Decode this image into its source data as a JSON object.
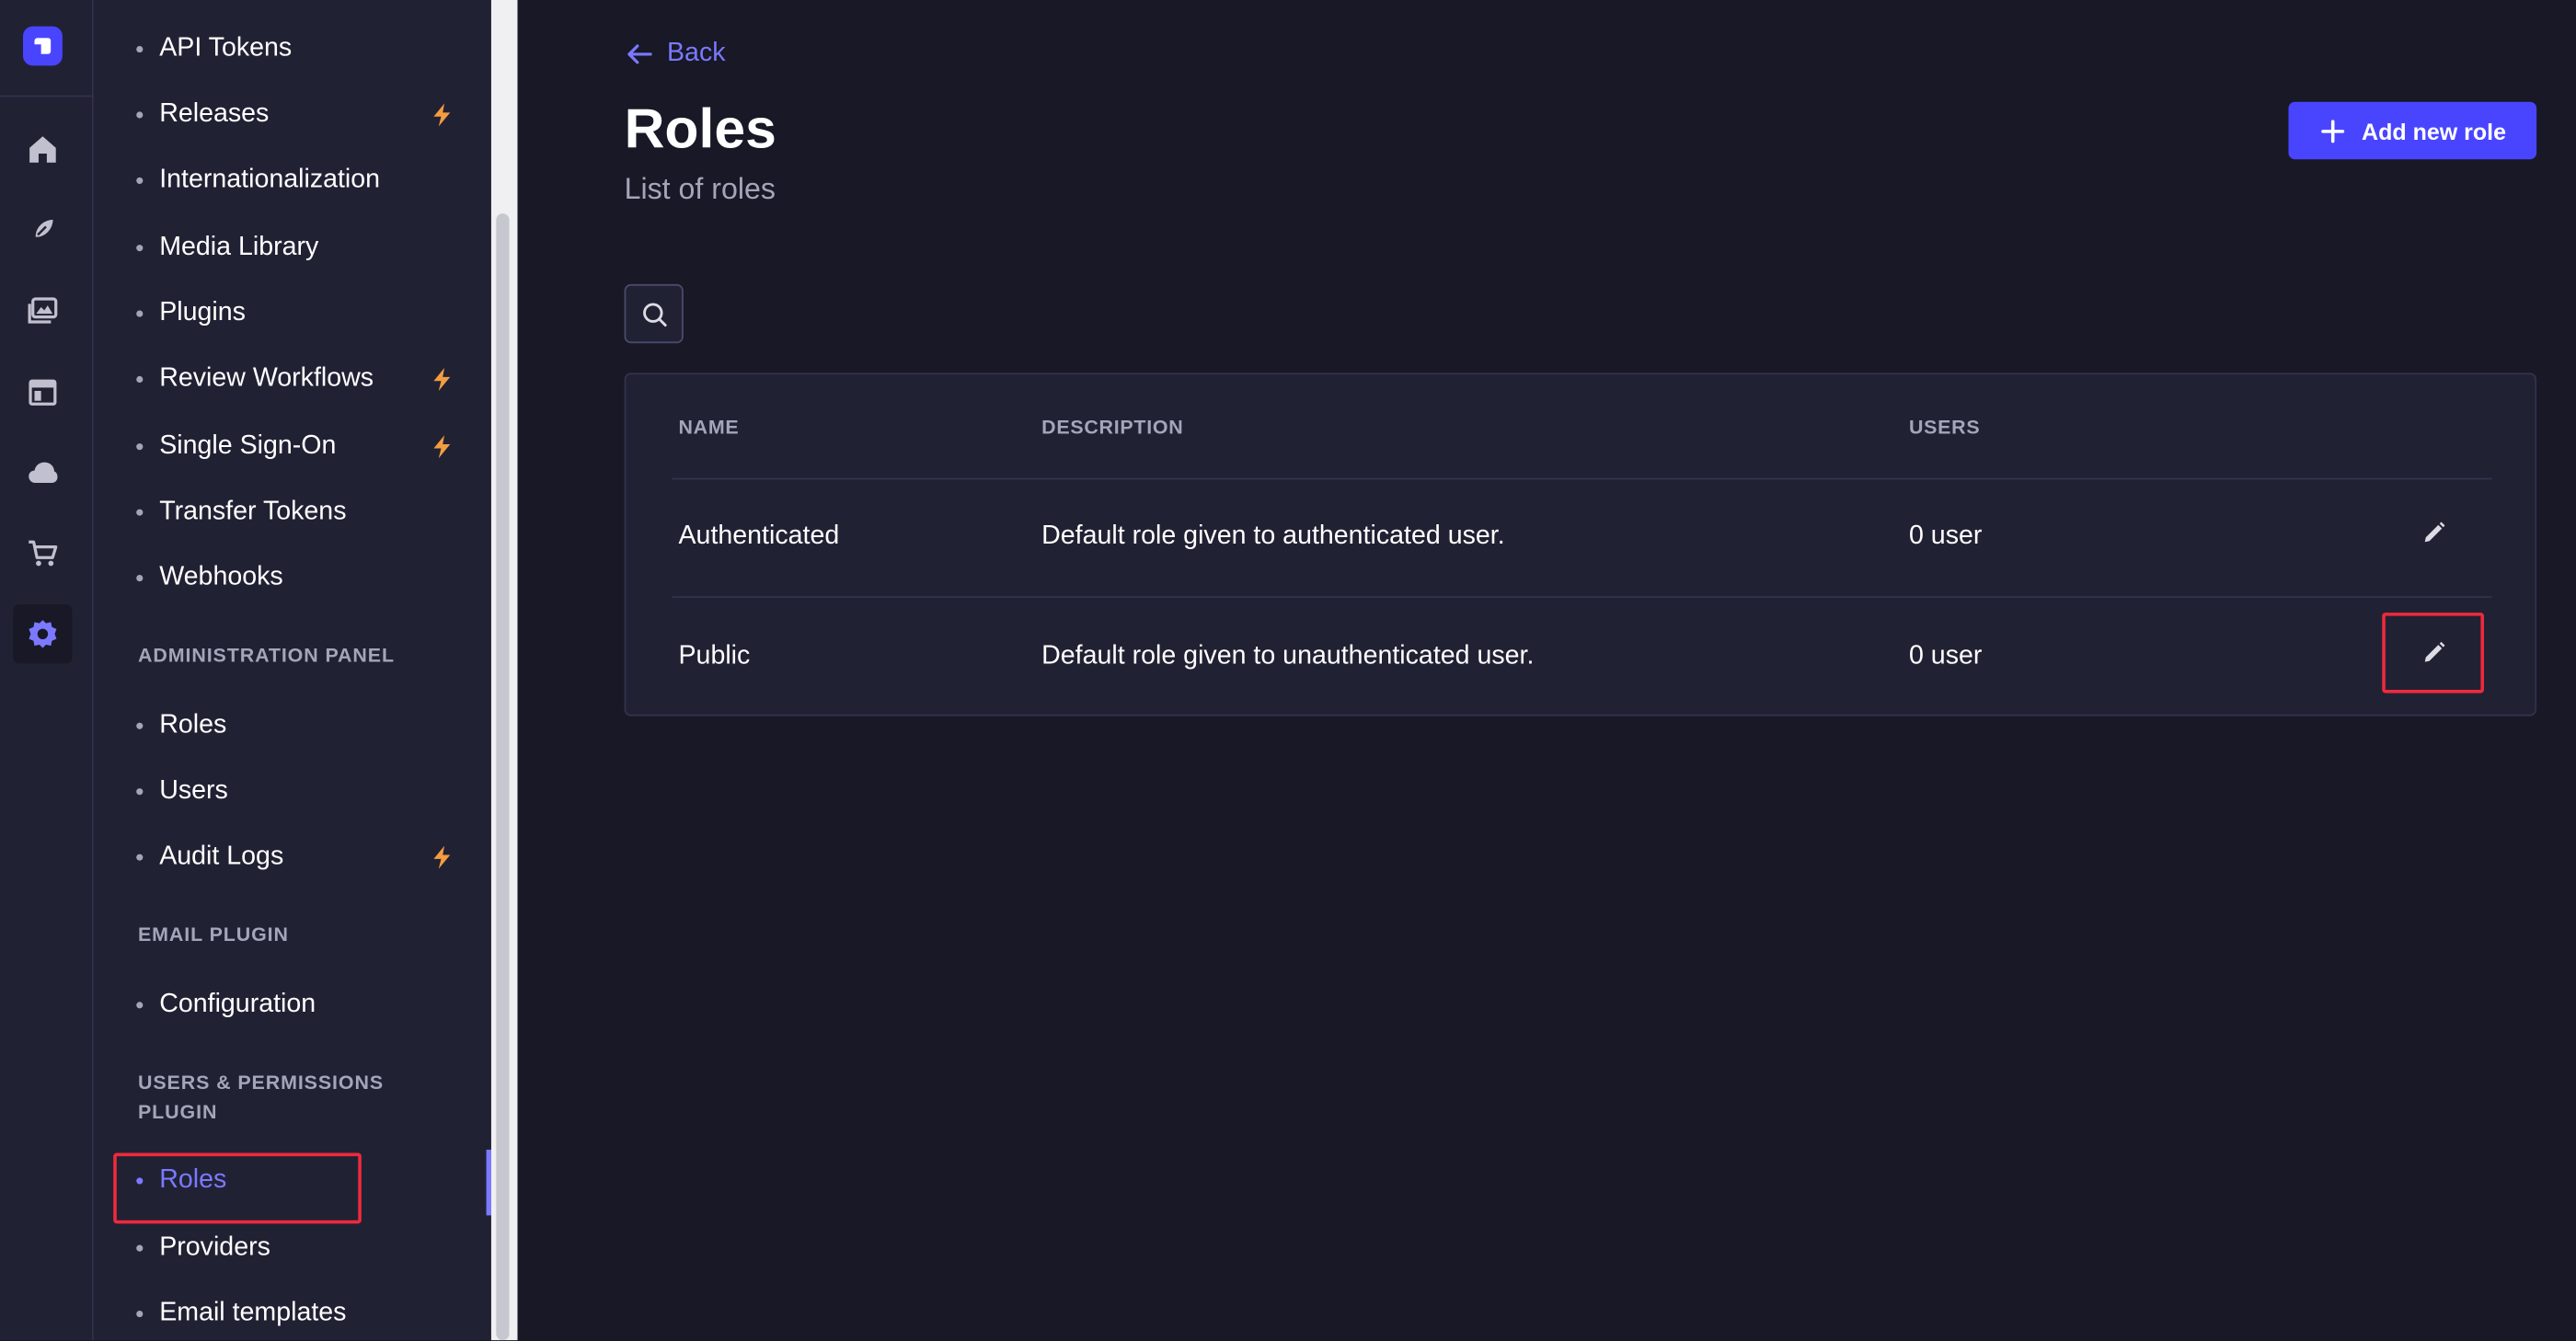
{
  "settings_nav": {
    "global_items": [
      {
        "label": "API Tokens",
        "premium": false
      },
      {
        "label": "Releases",
        "premium": true
      },
      {
        "label": "Internationalization",
        "premium": false
      },
      {
        "label": "Media Library",
        "premium": false
      },
      {
        "label": "Plugins",
        "premium": false
      },
      {
        "label": "Review Workflows",
        "premium": true
      },
      {
        "label": "Single Sign-On",
        "premium": true
      },
      {
        "label": "Transfer Tokens",
        "premium": false
      },
      {
        "label": "Webhooks",
        "premium": false
      }
    ],
    "admin_section": "ADMINISTRATION PANEL",
    "admin_items": [
      {
        "label": "Roles",
        "premium": false
      },
      {
        "label": "Users",
        "premium": false
      },
      {
        "label": "Audit Logs",
        "premium": true
      }
    ],
    "email_section": "EMAIL PLUGIN",
    "email_items": [
      {
        "label": "Configuration"
      }
    ],
    "up_section": "USERS & PERMISSIONS PLUGIN",
    "up_items": [
      {
        "label": "Roles",
        "active": true
      },
      {
        "label": "Providers"
      },
      {
        "label": "Email templates"
      }
    ]
  },
  "header": {
    "back_label": "Back",
    "title": "Roles",
    "subtitle": "List of roles",
    "add_button": "Add new role"
  },
  "table": {
    "columns": [
      "NAME",
      "DESCRIPTION",
      "USERS"
    ],
    "rows": [
      {
        "name": "Authenticated",
        "description": "Default role given to authenticated user.",
        "users": "0 user"
      },
      {
        "name": "Public",
        "description": "Default role given to unauthenticated user.",
        "users": "0 user"
      }
    ]
  },
  "colors": {
    "accent": "#4945ff",
    "link": "#7b79ff",
    "premium_bolt": "#f29d41",
    "highlight": "#ee2a3c"
  },
  "icons": {
    "rail": [
      "home-icon",
      "feather-icon",
      "images-icon",
      "layout-icon",
      "cloud-icon",
      "cart-icon",
      "cog-icon"
    ],
    "back": "arrow-left-icon",
    "add": "plus-icon",
    "search": "search-icon",
    "edit": "pencil-icon",
    "premium": "lightning-icon"
  }
}
